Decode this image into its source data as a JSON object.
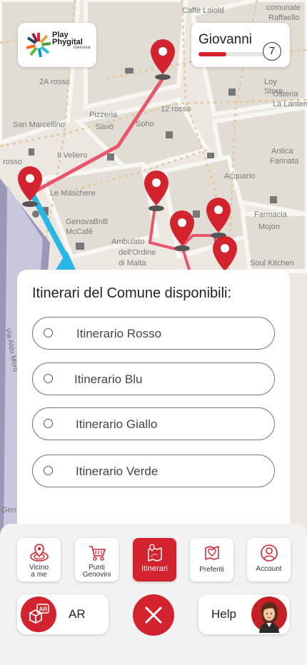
{
  "colors": {
    "accent": "#d2232f",
    "route": "#e8566b",
    "route_blue": "#2bb6e8"
  },
  "map": {
    "labels": [
      "Caffè Laiold",
      "comunale",
      "Raffaello",
      "2A rosso",
      "Loy",
      "Store",
      "12 rosso",
      "Osteria",
      "La Lantern",
      "Pizzeria",
      "Savò",
      "Soho",
      "San Marcellino",
      "Il Veliero",
      "Antica",
      "Farinata",
      "Acquario",
      "rosso",
      "Le Maschere",
      "GenovaBnB",
      "McCafé",
      "Farmacia",
      "Mojon",
      "Ambulato",
      "dell'Ordine",
      "di Malta",
      "Soul Kitchen",
      "Via Aldo Moro",
      "Gen"
    ]
  },
  "header": {
    "logo_title_1": "Play",
    "logo_title_2": "Phygital",
    "logo_sub": "Genova",
    "user_name": "Giovanni",
    "user_level": "7",
    "user_progress": 0.42
  },
  "panel": {
    "title": "Itinerari del Comune disponibili:",
    "options": [
      {
        "label": "Itinerario Rosso"
      },
      {
        "label": "Itinerario Blu"
      },
      {
        "label": "Itinerario Giallo"
      },
      {
        "label": "Itinerario Verde"
      }
    ]
  },
  "nav": {
    "items": [
      {
        "label_1": "Vicino",
        "label_2": "a me",
        "icon": "map-pin-icon"
      },
      {
        "label_1": "Punti",
        "label_2": "Genovini",
        "icon": "cart-icon"
      },
      {
        "label_1": "Itinerari",
        "label_2": "",
        "icon": "route-map-icon"
      },
      {
        "label_1": "Preferiti",
        "label_2": "",
        "icon": "heart-map-icon"
      },
      {
        "label_1": "Account",
        "label_2": "",
        "icon": "user-icon"
      }
    ],
    "ar_label": "AR",
    "ar_badge": "AR",
    "help_label": "Help"
  }
}
